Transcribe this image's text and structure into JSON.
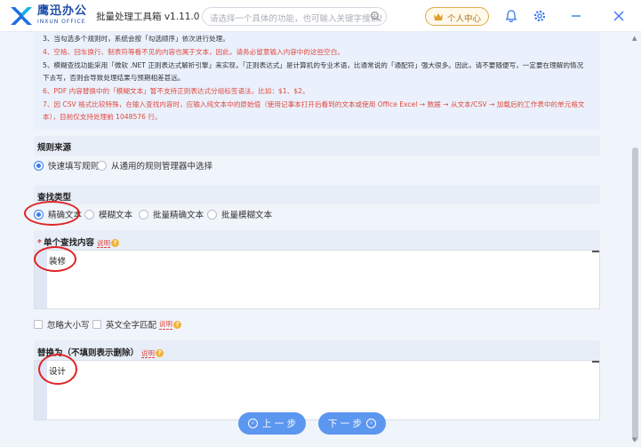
{
  "header": {
    "brand_name": "鹰迅办公",
    "brand_sub": "INXUN OFFICE",
    "app_name": "批量处理工具箱 v1.11.0",
    "search_placeholder": "请选择一个具体的功能，也可输入关键字搜索！",
    "user_center_label": "个人中心"
  },
  "notice": {
    "lines": [
      {
        "text": "3、当勾选多个规则时，系统会按「勾选顺序」依次进行处理。",
        "color": "dark"
      },
      {
        "text": "4、空格、回车换行、制表符等看不见的内容也属于文本，因此，请务必留意输入内容中的这些空白。",
        "color": "red"
      },
      {
        "text": "5、模糊查找功能采用「微软 .NET 正则表达式解析引擎」来实现，「正则表达式」是计算机的专业术语，比通常说的「通配符」强大很多。因此，请不要随便写，一定要在理解的情况下去写，否则会导致处理结果与预期相差甚远。",
        "color": "dark"
      },
      {
        "text": "6、PDF 内容替换中的「模糊文本」暂不支持正则表达式分组标签语法，比如：$1、$2。",
        "color": "red"
      },
      {
        "text": "7、因 CSV 格式比较特殊，在输入查找内容时，应输入纯文本中的原始值（使用记事本打开后看到的文本或使用 Office Excel → 数据 → 从文本/CSV → 加载后的工作表中的单元格文本），目前仅支持处理前 1048576 行。",
        "color": "red"
      }
    ]
  },
  "rule_source": {
    "title": "规则来源",
    "options": [
      "快速填写规则",
      "从通用的规则管理器中选择"
    ],
    "selected": 0
  },
  "find_type": {
    "title": "查找类型",
    "options": [
      "精确文本",
      "模糊文本",
      "批量精确文本",
      "批量模糊文本"
    ],
    "selected": 0
  },
  "single_find": {
    "required_mark": "*",
    "title": "单个查找内容",
    "explain": "说明",
    "value": "装修"
  },
  "options": {
    "ignore_case": "忽略大小写",
    "full_word": "英文全字匹配",
    "explain": "说明"
  },
  "replace": {
    "title": "替换为（不填则表示删除）",
    "explain": "说明",
    "value": "设计"
  },
  "nav": {
    "prev_label": "上 一 步",
    "next_label": "下 一 步"
  },
  "colors": {
    "accent": "#3a7bea",
    "button": "#5b96ef",
    "annotation": "#e02424",
    "warning_text": "#e04a3d"
  }
}
